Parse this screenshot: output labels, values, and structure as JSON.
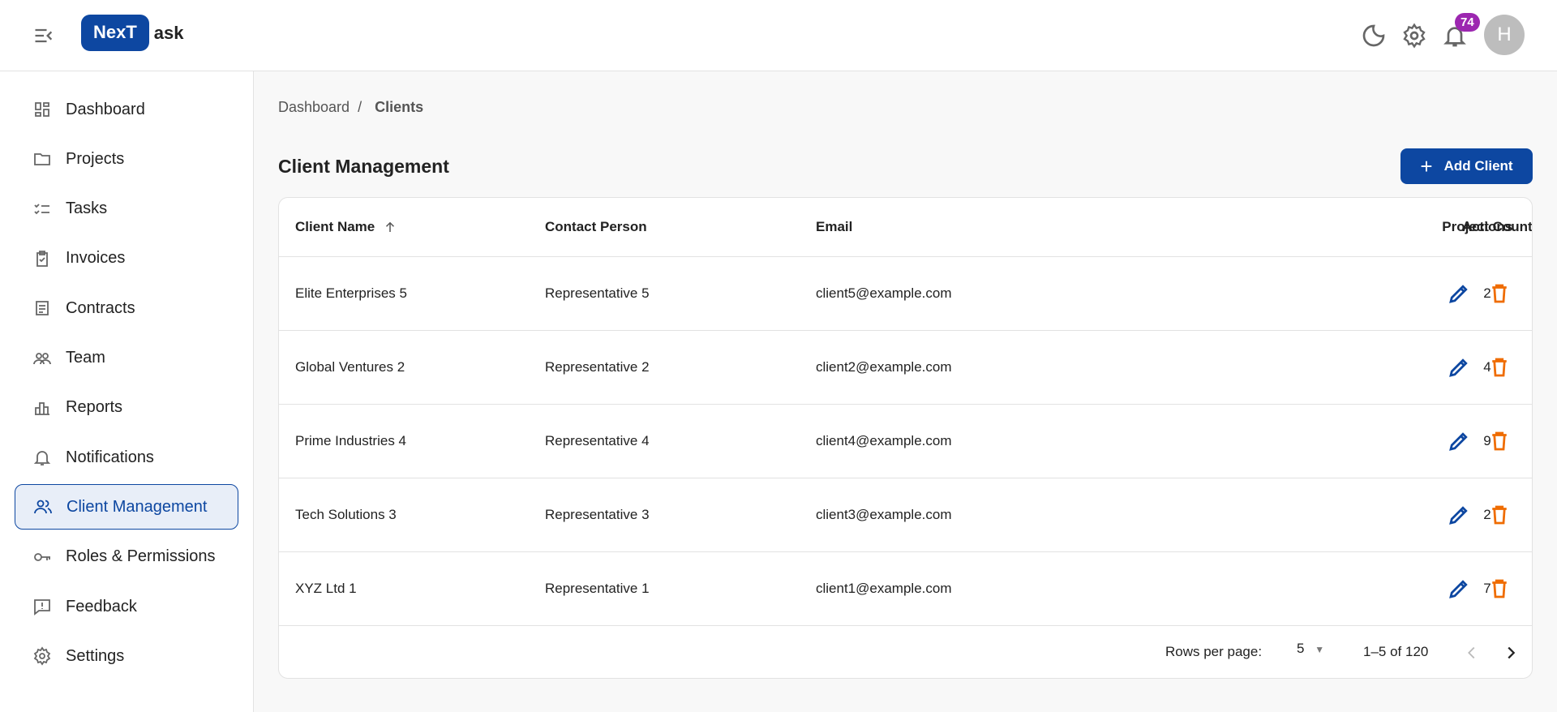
{
  "header": {
    "logo_box": "NexT",
    "logo_rest": "ask",
    "notification_count": "74",
    "avatar_initial": "H"
  },
  "sidebar": {
    "items": [
      {
        "label": "Dashboard",
        "icon": "dashboard-icon"
      },
      {
        "label": "Projects",
        "icon": "folder-icon"
      },
      {
        "label": "Tasks",
        "icon": "checklist-icon"
      },
      {
        "label": "Invoices",
        "icon": "clipboard-check-icon"
      },
      {
        "label": "Contracts",
        "icon": "document-icon"
      },
      {
        "label": "Team",
        "icon": "team-icon"
      },
      {
        "label": "Reports",
        "icon": "bar-chart-icon"
      },
      {
        "label": "Notifications",
        "icon": "bell-icon"
      },
      {
        "label": "Client Management",
        "icon": "people-icon",
        "active": true
      },
      {
        "label": "Roles & Permissions",
        "icon": "key-icon"
      },
      {
        "label": "Feedback",
        "icon": "feedback-icon"
      },
      {
        "label": "Settings",
        "icon": "gear-icon"
      }
    ]
  },
  "breadcrumb": {
    "parent": "Dashboard",
    "separator": "/",
    "current": "Clients"
  },
  "page": {
    "title": "Client Management",
    "add_button": "Add Client"
  },
  "table": {
    "columns": [
      "Client Name",
      "Contact Person",
      "Email",
      "Project Count",
      "Actions"
    ],
    "rows": [
      {
        "name": "Elite Enterprises 5",
        "contact": "Representative 5",
        "email": "client5@example.com",
        "count": "2"
      },
      {
        "name": "Global Ventures 2",
        "contact": "Representative 2",
        "email": "client2@example.com",
        "count": "4"
      },
      {
        "name": "Prime Industries 4",
        "contact": "Representative 4",
        "email": "client4@example.com",
        "count": "9"
      },
      {
        "name": "Tech Solutions 3",
        "contact": "Representative 3",
        "email": "client3@example.com",
        "count": "2"
      },
      {
        "name": "XYZ Ltd 1",
        "contact": "Representative 1",
        "email": "client1@example.com",
        "count": "7"
      }
    ],
    "footer": {
      "rows_per_page_label": "Rows per page:",
      "rows_per_page": "5",
      "range": "1–5 of 120"
    }
  },
  "colors": {
    "primary": "#0d47a1",
    "delete": "#ef6c00",
    "badge": "#9c27b0"
  }
}
